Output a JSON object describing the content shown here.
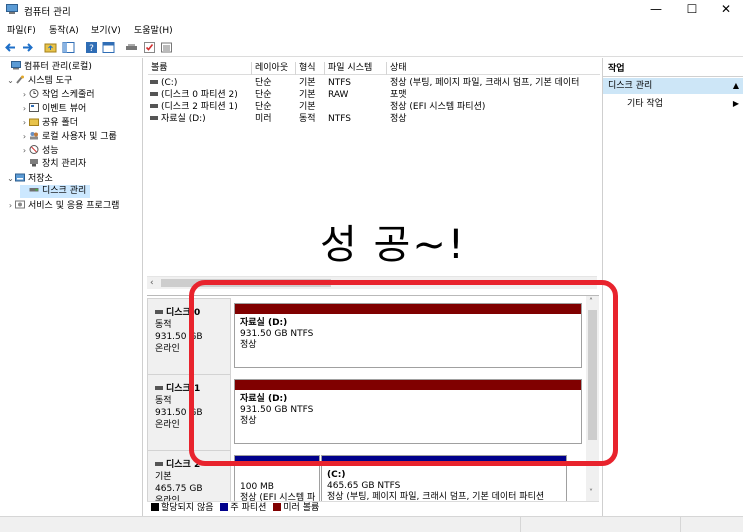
{
  "window": {
    "title": "컴퓨터 관리",
    "minimize": "—",
    "maximize": "☐",
    "close": "✕"
  },
  "menu": [
    "파일(F)",
    "동작(A)",
    "보기(V)",
    "도움말(H)"
  ],
  "colors": {
    "primary_partition": "#00008b",
    "mirror_volume": "#800000",
    "unallocated": "#000000",
    "selection": "#cce8ff",
    "highlight": "#e8232d"
  },
  "tree": [
    {
      "label": "컴퓨터 관리(로컬)",
      "twisty": "",
      "icon": "computer-icon"
    },
    {
      "label": "시스템 도구",
      "twisty": "⌄",
      "icon": "tools-icon"
    },
    {
      "label": "작업 스케줄러",
      "twisty": "›",
      "icon": "clock-icon"
    },
    {
      "label": "이벤트 뷰어",
      "twisty": "›",
      "icon": "event-icon"
    },
    {
      "label": "공유 폴더",
      "twisty": "›",
      "icon": "folder-icon"
    },
    {
      "label": "로컬 사용자 및 그룹",
      "twisty": "›",
      "icon": "users-icon"
    },
    {
      "label": "성능",
      "twisty": "›",
      "icon": "performance-icon"
    },
    {
      "label": "장치 관리자",
      "twisty": "",
      "icon": "device-icon"
    },
    {
      "label": "저장소",
      "twisty": "⌄",
      "icon": "storage-icon"
    },
    {
      "label": "디스크 관리",
      "twisty": "",
      "icon": "disk-icon"
    },
    {
      "label": "서비스 및 응용 프로그램",
      "twisty": "›",
      "icon": "services-icon"
    }
  ],
  "volumes": {
    "headers": [
      "볼륨",
      "레이아웃",
      "형식",
      "파일 시스템",
      "상태"
    ],
    "rows": [
      [
        "(C:)",
        "단순",
        "기본",
        "NTFS",
        "정상 (부팅, 페이지 파일, 크래시 덤프, 기본 데이터"
      ],
      [
        "(디스크 0 파티션 2)",
        "단순",
        "기본",
        "RAW",
        "포맷"
      ],
      [
        "(디스크 2 파티션 1)",
        "단순",
        "기본",
        "",
        "정상 (EFI 시스템 파티션)"
      ],
      [
        "자료실 (D:)",
        "미러",
        "동적",
        "NTFS",
        "정상"
      ]
    ]
  },
  "overlay_text": "성 공~!",
  "disks": [
    {
      "name": "디스크 0",
      "type": "동적",
      "size": "931.50 GB",
      "state": "온라인",
      "partitions": [
        {
          "name": "자료실  (D:)",
          "size": "931.50 GB NTFS",
          "status": "정상",
          "kind": "mirror"
        }
      ]
    },
    {
      "name": "디스크 1",
      "type": "동적",
      "size": "931.50 GB",
      "state": "온라인",
      "partitions": [
        {
          "name": "자료실  (D:)",
          "size": "931.50 GB NTFS",
          "status": "정상",
          "kind": "mirror"
        }
      ]
    },
    {
      "name": "디스크 2",
      "type": "기본",
      "size": "465.75 GB",
      "state": "온라인",
      "partitions": [
        {
          "name": "",
          "size": "100 MB",
          "status": "정상 (EFI 시스템 파",
          "kind": "primary"
        },
        {
          "name": "(C:)",
          "size": "465.65 GB NTFS",
          "status": "정상 (부팅, 페이지 파일, 크래시 덤프, 기본 데이터 파티션",
          "kind": "primary"
        }
      ]
    }
  ],
  "legend": [
    {
      "label": "할당되지 않음",
      "color": "#000000"
    },
    {
      "label": "주 파티션",
      "color": "#00008b"
    },
    {
      "label": "미러 볼륨",
      "color": "#800000"
    }
  ],
  "actions": {
    "header": "작업",
    "section": "디스크 관리",
    "item": "기타 작업"
  }
}
